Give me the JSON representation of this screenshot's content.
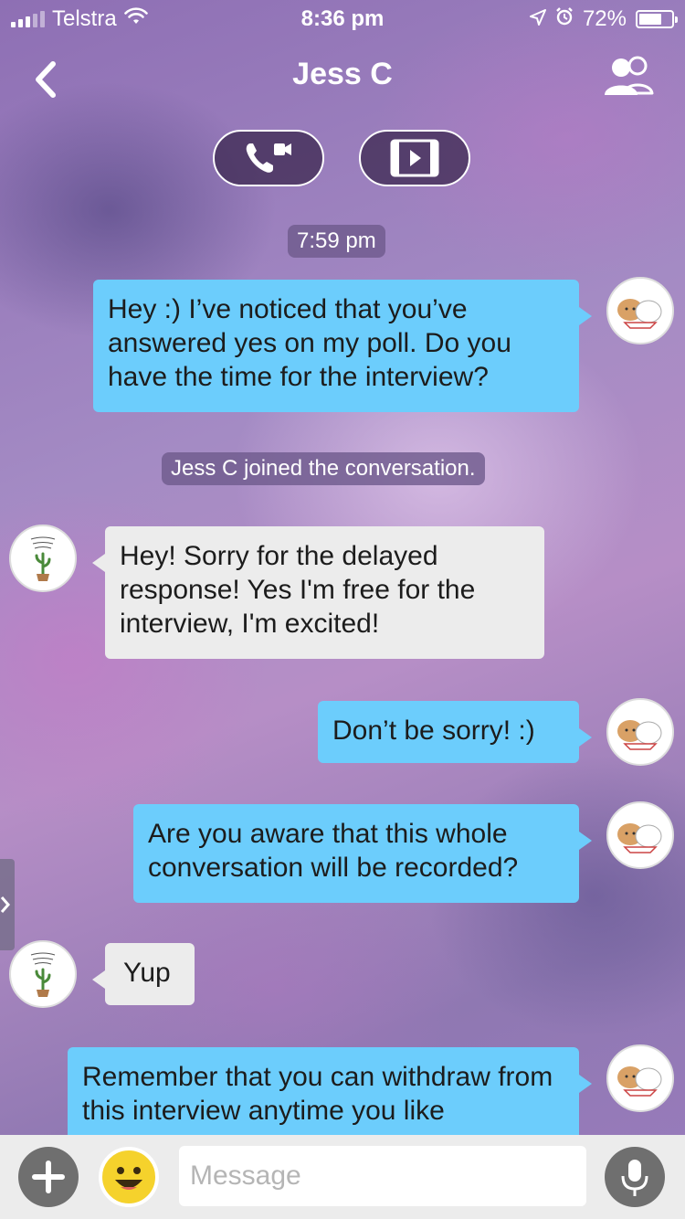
{
  "status_bar": {
    "carrier": "Telstra",
    "time": "8:36 pm",
    "battery": "72%",
    "battery_level": 0.72,
    "icons": [
      "signal-icon",
      "wifi-icon",
      "location-icon",
      "alarm-icon",
      "battery-icon"
    ]
  },
  "header": {
    "title": "Jess C",
    "back_icon": "chevron-left-icon",
    "group_icon": "group-icon"
  },
  "actions": {
    "call_icon": "video-call-icon",
    "video_icon": "film-play-icon"
  },
  "conversation": {
    "timestamp": "7:59 pm",
    "system_message": "Jess C joined the conversation.",
    "messages": [
      {
        "sender": "me",
        "text": "Hey :) I’ve noticed that you’ve answered yes on my poll. Do you have the time for the interview?"
      },
      {
        "sender": "Jess C",
        "text": "Hey! Sorry for the delayed response! Yes I'm free for the interview, I'm excited!"
      },
      {
        "sender": "me",
        "text": "Don’t be sorry! :)"
      },
      {
        "sender": "me",
        "text": "Are you aware that this whole conversation will be recorded?"
      },
      {
        "sender": "Jess C",
        "text": "Yup"
      },
      {
        "sender": "me",
        "text": "Remember that you can withdraw from this interview anytime you like"
      }
    ]
  },
  "composer": {
    "placeholder": "Message",
    "plus_icon": "plus-icon",
    "emoji_icon": "emoji-icon",
    "mic_icon": "microphone-icon"
  },
  "colors": {
    "outgoing_bubble": "#6ccdfc",
    "incoming_bubble": "#ececec",
    "bottom_bar": "#ececec"
  }
}
